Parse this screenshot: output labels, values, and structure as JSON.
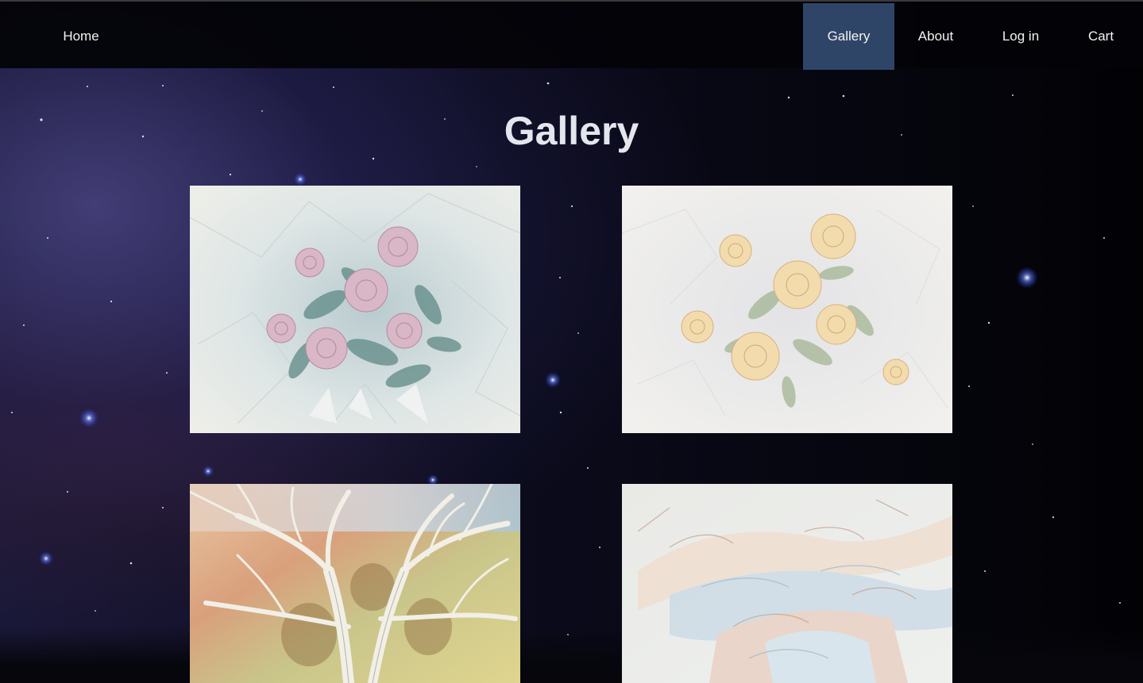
{
  "nav": {
    "home": "Home",
    "gallery": "Gallery",
    "about": "About",
    "login": "Log in",
    "cart": "Cart",
    "active_color": "#2f4568"
  },
  "page": {
    "title": "Gallery"
  },
  "gallery": {
    "items": [
      {
        "subject": "pink roses watercolor"
      },
      {
        "subject": "yellow roses watercolor"
      },
      {
        "subject": "white tree branches watercolor"
      },
      {
        "subject": "pale horses watercolor"
      }
    ]
  }
}
